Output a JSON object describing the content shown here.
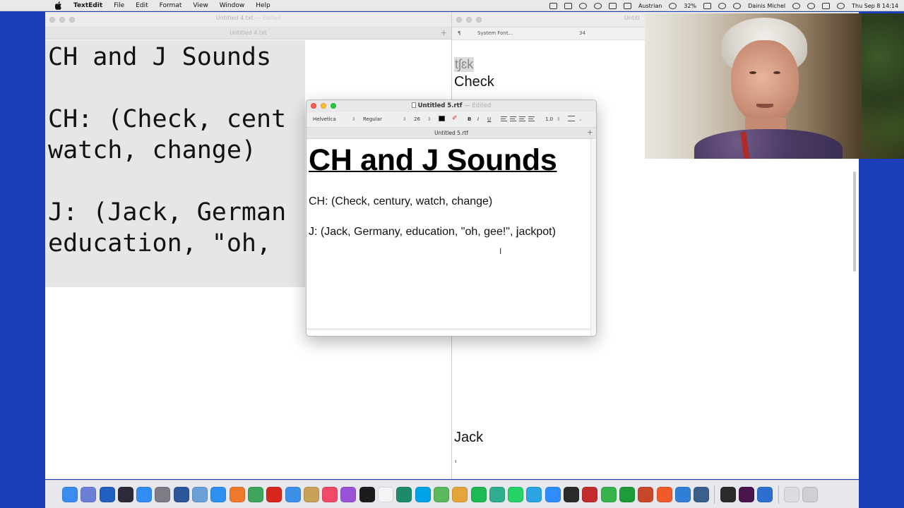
{
  "menubar": {
    "app_name": "TextEdit",
    "items": [
      "File",
      "Edit",
      "Format",
      "View",
      "Window",
      "Help"
    ],
    "status": {
      "keyboard_layout": "Austrian",
      "battery": "32%",
      "user": "Dainis Michel",
      "datetime": "Thu Sep 8  14:14"
    }
  },
  "left_window": {
    "title": "Untitled 4.txt",
    "title_suffix": "— Edited",
    "tab_name": "Untitled 4.txt",
    "lines": [
      "CH and J Sounds",
      "",
      "CH: (Check, cent",
      "watch, change)",
      "",
      "J: (Jack, German",
      "education, \"oh, "
    ]
  },
  "right_window": {
    "title": "Untitl",
    "toolbar": {
      "paragraph": "¶",
      "font": "System Font...",
      "size": "34"
    },
    "ipa": "tʃɛk",
    "word_check": "Check",
    "word_jack": "Jack",
    "trailing": ","
  },
  "center_window": {
    "title": "Untitled 5.rtf",
    "separator": "—",
    "title_suffix": "Edited",
    "toolbar": {
      "font": "Helvetica",
      "style": "Regular",
      "size": "26",
      "bold": "B",
      "italic": "I",
      "underline": "U",
      "spacing": "1.0"
    },
    "tab_name": "Untitled 5.rtf",
    "heading": "CH and J Sounds",
    "line_ch": "CH: (Check, century, watch, change)",
    "line_j_before": "J: (Jack, Germany, education, \"oh, gee!\", ",
    "line_j_selected": "j",
    "line_j_after": "ackpot)"
  },
  "dock": {
    "icons": [
      {
        "name": "finder-icon",
        "color": "#3b8cf0"
      },
      {
        "name": "launchpad-icon",
        "color": "#6b7fd6"
      },
      {
        "name": "xcode-icon",
        "color": "#1f5fbf"
      },
      {
        "name": "simulator-icon",
        "color": "#2a2a3a"
      },
      {
        "name": "app-store-icon",
        "color": "#2f8df5"
      },
      {
        "name": "system-preferences-icon",
        "color": "#7c7c84"
      },
      {
        "name": "word-icon",
        "color": "#2b579a"
      },
      {
        "name": "preview-icon",
        "color": "#6a9fd8"
      },
      {
        "name": "safari-icon",
        "color": "#2e8ff0"
      },
      {
        "name": "firefox-icon",
        "color": "#f07a2b"
      },
      {
        "name": "chrome-icon",
        "color": "#3ea55a"
      },
      {
        "name": "acrobat-icon",
        "color": "#d8261d"
      },
      {
        "name": "mail-icon",
        "color": "#3c90e8"
      },
      {
        "name": "notes-icon",
        "color": "#c9a25a"
      },
      {
        "name": "music-icon",
        "color": "#f04a68"
      },
      {
        "name": "podcasts-icon",
        "color": "#9a52d6"
      },
      {
        "name": "apple-tv-icon",
        "color": "#1c1c1e"
      },
      {
        "name": "calendar-icon",
        "color": "#f4f4f4"
      },
      {
        "name": "time-machine-icon",
        "color": "#1d8a6a"
      },
      {
        "name": "skype-icon",
        "color": "#00a2e8"
      },
      {
        "name": "maps-icon",
        "color": "#5bb85c"
      },
      {
        "name": "photos-icon",
        "color": "#e6a53a"
      },
      {
        "name": "spotify-icon",
        "color": "#1db954"
      },
      {
        "name": "feather-icon",
        "color": "#2fae8f"
      },
      {
        "name": "whatsapp-icon",
        "color": "#25d366"
      },
      {
        "name": "telegram-icon",
        "color": "#2ba5e2"
      },
      {
        "name": "zoom-icon",
        "color": "#2d8cff"
      },
      {
        "name": "activity-monitor-icon",
        "color": "#2a2a2a"
      },
      {
        "name": "photo-booth-icon",
        "color": "#c22c2c"
      },
      {
        "name": "facetime-icon",
        "color": "#36b34a"
      },
      {
        "name": "numbers-icon",
        "color": "#1f9c3a"
      },
      {
        "name": "powerpoint-icon",
        "color": "#c8472b"
      },
      {
        "name": "brave-icon",
        "color": "#f05a28"
      },
      {
        "name": "xcode-instruments-icon",
        "color": "#2f7fd8"
      },
      {
        "name": "virtual-machine-icon",
        "color": "#3a5f8a"
      },
      {
        "name": "sep",
        "color": ""
      },
      {
        "name": "terminal-icon",
        "color": "#2b2b2b"
      },
      {
        "name": "slack-icon",
        "color": "#4a154b"
      },
      {
        "name": "quicktime-icon",
        "color": "#2c6fd0"
      },
      {
        "name": "sep",
        "color": ""
      },
      {
        "name": "downloads-icon",
        "color": "#dcdce2"
      },
      {
        "name": "trash-icon",
        "color": "#cfcfd6"
      }
    ]
  }
}
